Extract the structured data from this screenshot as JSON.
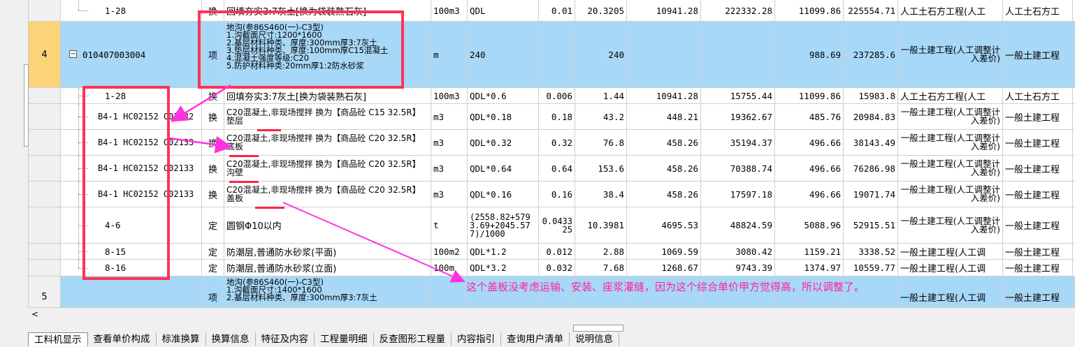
{
  "rows": [
    {
      "idx": "",
      "code": "1-28",
      "type": "换",
      "name": "回填夯实3:7灰土[换为袋装熟石灰]",
      "unit": "100m3",
      "qty_expr": "QDL",
      "coef": "0.01",
      "qty": "20.3205",
      "price": "10941.28",
      "total": "222332.28",
      "adj_price": "11099.86",
      "adj_total": "225554.71",
      "category": "人工土石方工程(人工",
      "sub": "人工土石方工"
    },
    {
      "idx": "4",
      "code": "010407003004",
      "type": "项",
      "desc": [
        "地沟(参86S460(一)-C3型)",
        "1.沟截面尺寸:1200*1600",
        "2.基层材料种类、厚度:300mm厚3:7灰土",
        "3.垫层材料种类、厚度:100mm厚C15混凝土",
        "4.混凝土强度等级:C20",
        "5.防护材料种类:20mm厚1:2防水砂浆"
      ],
      "unit": "m",
      "qty_expr": "240",
      "coef": "",
      "qty": "240",
      "price": "",
      "total": "",
      "adj_price": "988.69",
      "adj_total": "237285.6",
      "category": "一般土建工程(人工调整计入差价)",
      "sub": "一般土建工程"
    },
    {
      "idx": "",
      "code": "1-28",
      "type": "换",
      "name": "回填夯实3:7灰土[换为袋装熟石灰]",
      "unit": "100m3",
      "qty_expr": "QDL*0.6",
      "coef": "0.006",
      "qty": "1.44",
      "price": "10941.28",
      "total": "15755.44",
      "adj_price": "11099.86",
      "adj_total": "15983.8",
      "category": "人工土石方工程(人工",
      "sub": "人工土石方工"
    },
    {
      "idx": "",
      "code": "B4-1 HC02152 C02132",
      "type": "换",
      "name": "C20混凝土,非现场搅拌 换为【商品砼 C15 32.5R】 垫层",
      "unit": "m3",
      "qty_expr": "QDL*0.18",
      "coef": "0.18",
      "qty": "43.2",
      "price": "448.21",
      "total": "19362.67",
      "adj_price": "485.76",
      "adj_total": "20984.83",
      "category": "一般土建工程(人工调整计入差价)",
      "sub": "一般土建工程"
    },
    {
      "idx": "",
      "code": "B4-1 HC02152 C02133",
      "type": "换",
      "name": "C20混凝土,非现场搅拌 换为【商品砼 C20 32.5R】 底板",
      "unit": "m3",
      "qty_expr": "QDL*0.32",
      "coef": "0.32",
      "qty": "76.8",
      "price": "458.26",
      "total": "35194.37",
      "adj_price": "496.66",
      "adj_total": "38143.49",
      "category": "一般土建工程(人工调整计入差价)",
      "sub": "一般土建工程"
    },
    {
      "idx": "",
      "code": "B4-1 HC02152 C02133",
      "type": "换",
      "name": "C20混凝土,非现场搅拌 换为【商品砼 C20 32.5R】 沟壁",
      "unit": "m3",
      "qty_expr": "QDL*0.64",
      "coef": "0.64",
      "qty": "153.6",
      "price": "458.26",
      "total": "70388.74",
      "adj_price": "496.66",
      "adj_total": "76286.98",
      "category": "一般土建工程(人工调整计入差价)",
      "sub": "一般土建工程"
    },
    {
      "idx": "",
      "code": "B4-1 HC02152 C02133",
      "type": "换",
      "name": "C20混凝土,非现场搅拌 换为【商品砼 C20 32.5R】 盖板",
      "unit": "m3",
      "qty_expr": "QDL*0.16",
      "coef": "0.16",
      "qty": "38.4",
      "price": "458.26",
      "total": "17597.18",
      "adj_price": "496.66",
      "adj_total": "19071.74",
      "category": "一般土建工程(人工调整计入差价)",
      "sub": "一般土建工程"
    },
    {
      "idx": "",
      "code": "4-6",
      "type": "定",
      "name": "圆钢Φ10以内",
      "unit": "t",
      "qty_expr": "(2558.82+5793.69+2045.577)/1000",
      "coef": "0.043325",
      "qty": "10.3981",
      "price": "4695.53",
      "total": "48824.59",
      "adj_price": "5088.96",
      "adj_total": "52915.51",
      "category": "一般土建工程(人工调整计入差价)",
      "sub": "一般土建工程"
    },
    {
      "idx": "",
      "code": "8-15",
      "type": "定",
      "name": "防潮层,普通防水砂浆(平面)",
      "unit": "100m2",
      "qty_expr": "QDL*1.2",
      "coef": "0.012",
      "qty": "2.88",
      "price": "1069.59",
      "total": "3080.42",
      "adj_price": "1159.21",
      "adj_total": "3338.52",
      "category": "一般土建工程(人工调",
      "sub": "一般土建工程"
    },
    {
      "idx": "",
      "code": "8-16",
      "type": "定",
      "name": "防潮层,普通防水砂浆(立面)",
      "unit": "100m",
      "qty_expr": "QDL*3.2",
      "coef": "0.032",
      "qty": "7.68",
      "price": "1268.67",
      "total": "9743.39",
      "adj_price": "1374.97",
      "adj_total": "10559.77",
      "category": "一般土建工程(人工调",
      "sub": "一般土建工程"
    },
    {
      "idx": "5",
      "code": "",
      "type": "项",
      "desc": [
        "地沟(参86S460(一)-C3型)",
        "1.沟截面尺寸:1400*1600",
        "2.基层材料种类、厚度:300mm厚3:7灰土"
      ],
      "unit": "",
      "qty_expr": "",
      "coef": "",
      "qty": "",
      "price": "",
      "total": "",
      "adj_price": "",
      "adj_total": "",
      "category": "一般土建工程(人工调",
      "sub": "一般土建工程"
    }
  ],
  "annotation": "这个盖板没考虑运输、安装、座浆灌缝，因为这个综合单价甲方觉得高，所以调整了。",
  "tabs": [
    "工料机显示",
    "查看单价构成",
    "标准换算",
    "换算信息",
    "特征及内容",
    "工程量明细",
    "反查图形工程量",
    "内容指引",
    "查询用户清单",
    "说明信息"
  ],
  "scroll_left_icon": "chevron-left-icon"
}
